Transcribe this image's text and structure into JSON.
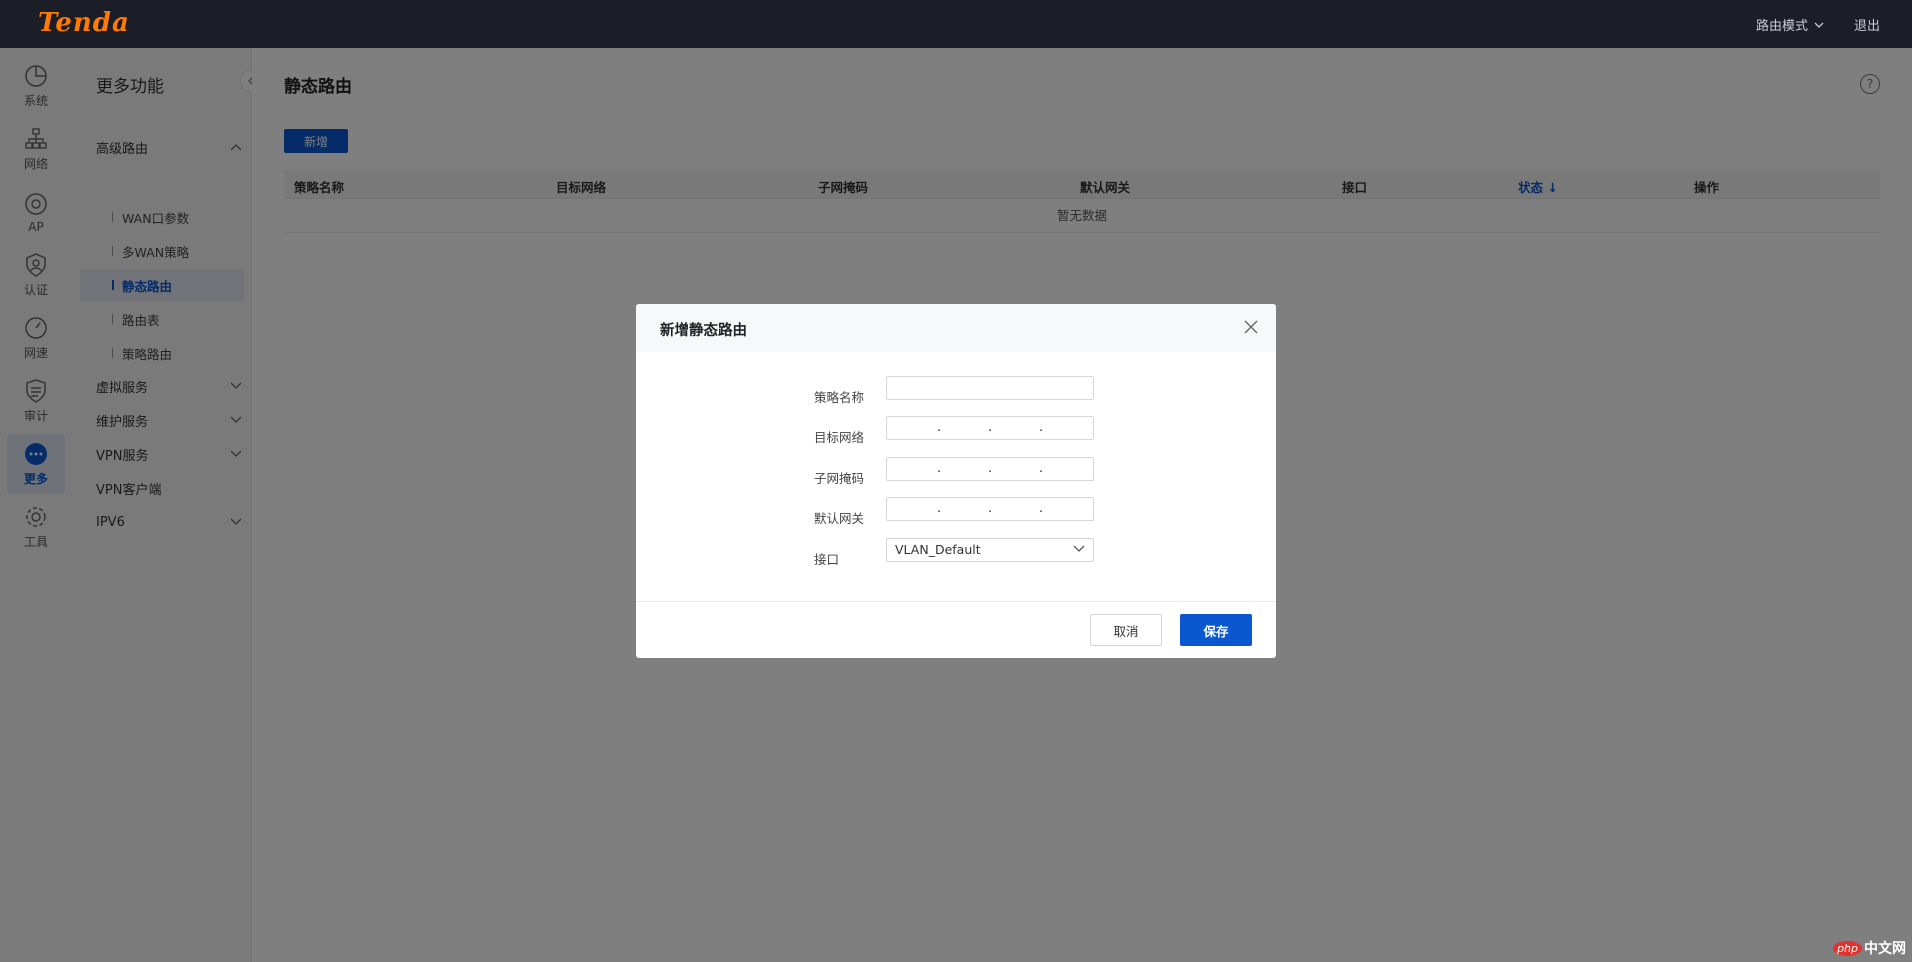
{
  "topbar": {
    "logo": "Tenda",
    "mode_label": "路由模式",
    "logout_label": "退出"
  },
  "rail": {
    "items": [
      {
        "label": "系统",
        "icon": "pie-chart-icon"
      },
      {
        "label": "网络",
        "icon": "network-icon"
      },
      {
        "label": "AP",
        "icon": "ap-icon"
      },
      {
        "label": "认证",
        "icon": "auth-icon"
      },
      {
        "label": "网速",
        "icon": "speed-icon"
      },
      {
        "label": "审计",
        "icon": "audit-icon"
      },
      {
        "label": "更多",
        "icon": "more-icon",
        "active": true
      },
      {
        "label": "工具",
        "icon": "gear-icon"
      }
    ]
  },
  "submenu": {
    "title": "更多功能",
    "groups": [
      {
        "label": "高级路由",
        "expanded": true,
        "children": [
          {
            "label": "WAN口参数"
          },
          {
            "label": "多WAN策略"
          },
          {
            "label": "静态路由",
            "active": true
          },
          {
            "label": "路由表"
          },
          {
            "label": "策略路由"
          }
        ]
      },
      {
        "label": "虚拟服务"
      },
      {
        "label": "维护服务"
      },
      {
        "label": "VPN服务"
      },
      {
        "label": "VPN客户端"
      },
      {
        "label": "IPV6"
      }
    ]
  },
  "main": {
    "title": "静态路由",
    "help": "?",
    "add_label": "新增",
    "columns": [
      "策略名称",
      "目标网络",
      "子网掩码",
      "默认网关",
      "接口",
      "状态 ↓",
      "操作"
    ],
    "empty_text": "暂无数据"
  },
  "modal": {
    "title": "新增静态路由",
    "fields": {
      "name_label": "策略名称",
      "name_value": "",
      "dest_label": "目标网络",
      "mask_label": "子网掩码",
      "gateway_label": "默认网关",
      "iface_label": "接口",
      "iface_value": "VLAN_Default"
    },
    "cancel_label": "取消",
    "save_label": "保存"
  },
  "watermark": {
    "php": "php",
    "text": "中文网"
  },
  "colors": {
    "accent": "#0b57d0",
    "logo": "#ff7a00",
    "topbar": "#1b1e27"
  }
}
